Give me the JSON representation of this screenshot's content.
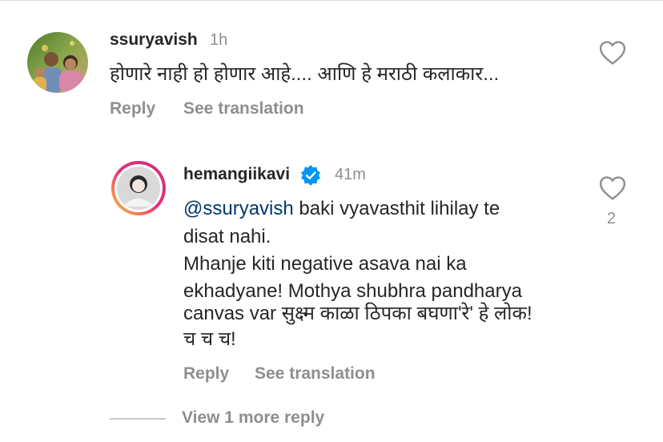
{
  "comments": [
    {
      "username": "ssuryavish",
      "time": "1h",
      "text": "होणारे नाही हो होणार आहे.... आणि हे मराठी कलाकार...",
      "reply_label": "Reply",
      "translate_label": "See translation",
      "like_icon": "heart-outline-icon"
    }
  ],
  "reply": {
    "username": "hemangiikavi",
    "verified_icon": "verified-badge-icon",
    "time": "41m",
    "mention": "@ssuryavish",
    "lines": [
      " baki vyavasthit lihilay te",
      "disat nahi.",
      "Mhanje kiti negative asava nai ka",
      "ekhadyane! Mothya shubhra pandharya",
      "canvas var सुक्ष्म काळा ठिपका बघणा'रे' हे लोक!",
      "च च च!"
    ],
    "reply_label": "Reply",
    "translate_label": "See translation",
    "like_count": "2",
    "like_icon": "heart-outline-icon"
  },
  "view_more_label": "View 1 more reply",
  "colors": {
    "text": "#262626",
    "muted": "#8e8e8e",
    "mention": "#00376b",
    "verified": "#0095f6"
  }
}
